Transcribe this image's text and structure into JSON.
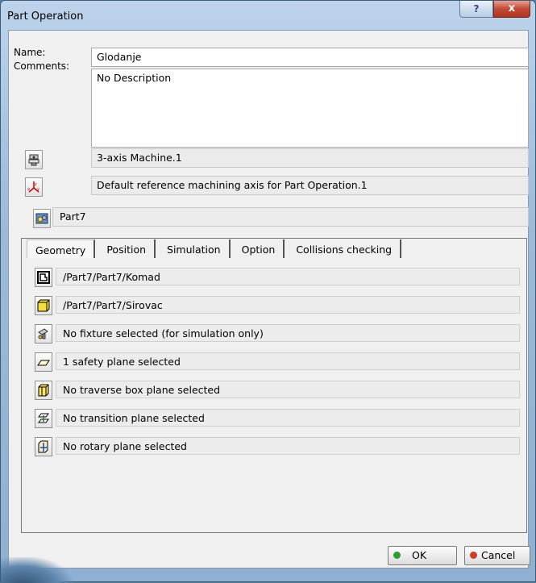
{
  "window": {
    "title": "Part Operation",
    "help_label": "?",
    "close_label": "x"
  },
  "form": {
    "name_label": "Name:",
    "name_value": "Glodanje",
    "comments_label": "Comments:",
    "comments_value": "No Description",
    "machine_value": "3-axis Machine.1",
    "axis_value": "Default reference machining axis for Part Operation.1",
    "product_value": "Part7"
  },
  "tabs": [
    {
      "label": "Geometry",
      "active": true
    },
    {
      "label": "Position",
      "active": false
    },
    {
      "label": "Simulation",
      "active": false
    },
    {
      "label": "Option",
      "active": false
    },
    {
      "label": "Collisions checking",
      "active": false
    }
  ],
  "geometry_rows": [
    {
      "icon": "design-part-icon",
      "value": "/Part7/Part7/Komad"
    },
    {
      "icon": "stock-icon",
      "value": "/Part7/Part7/Sirovac"
    },
    {
      "icon": "fixture-icon",
      "value": "No fixture selected (for simulation only)"
    },
    {
      "icon": "safety-plane-icon",
      "value": "1 safety plane selected"
    },
    {
      "icon": "traverse-box-icon",
      "value": "No traverse box plane selected"
    },
    {
      "icon": "transition-plane-icon",
      "value": "No transition plane selected"
    },
    {
      "icon": "rotary-plane-icon",
      "value": "No rotary plane selected"
    }
  ],
  "buttons": {
    "ok_label": "OK",
    "cancel_label": "Cancel"
  },
  "colors": {
    "ok_dot": "#2e9e2e",
    "cancel_dot": "#d23a2a",
    "titlebar": "#bcd3ea"
  }
}
